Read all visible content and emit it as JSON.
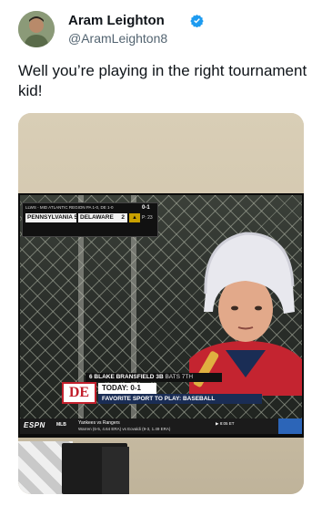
{
  "author": {
    "display_name": "Aram Leighton",
    "handle": "@AramLeighton8",
    "verified_icon": "verified-badge-icon",
    "verified_color": "#1d9bf0"
  },
  "tweet": {
    "text": "Well you’re playing in the right tournament kid!"
  },
  "broadcast": {
    "scorebug": {
      "region": "LLWS - MID ATLANTIC REGION PA 1-0, DE 1-0",
      "team1": "PENNSYLVANIA 5",
      "team2": "DELAWARE",
      "team2_score": "2",
      "count": "0-1",
      "pitch_count": "P: 23",
      "inning_color": "#c8a000"
    },
    "lower_third": {
      "player": "6  BLAKE BRANSFIELD",
      "position": "3B",
      "bats": "BATS 7TH",
      "logo_text": "DE",
      "today": "TODAY: 0-1",
      "fact": "FAVORITE SPORT TO PLAY: BASEBALL"
    },
    "ticker": {
      "network": "ESPN",
      "league": "MLB",
      "matchup": "Yankees vs Rangers",
      "pitchers": "Warren (6-5, 4.64 ERA) vs Eovaldi (9-3, 1.49 ERA)",
      "time": "▶ 8:05 ET"
    }
  }
}
